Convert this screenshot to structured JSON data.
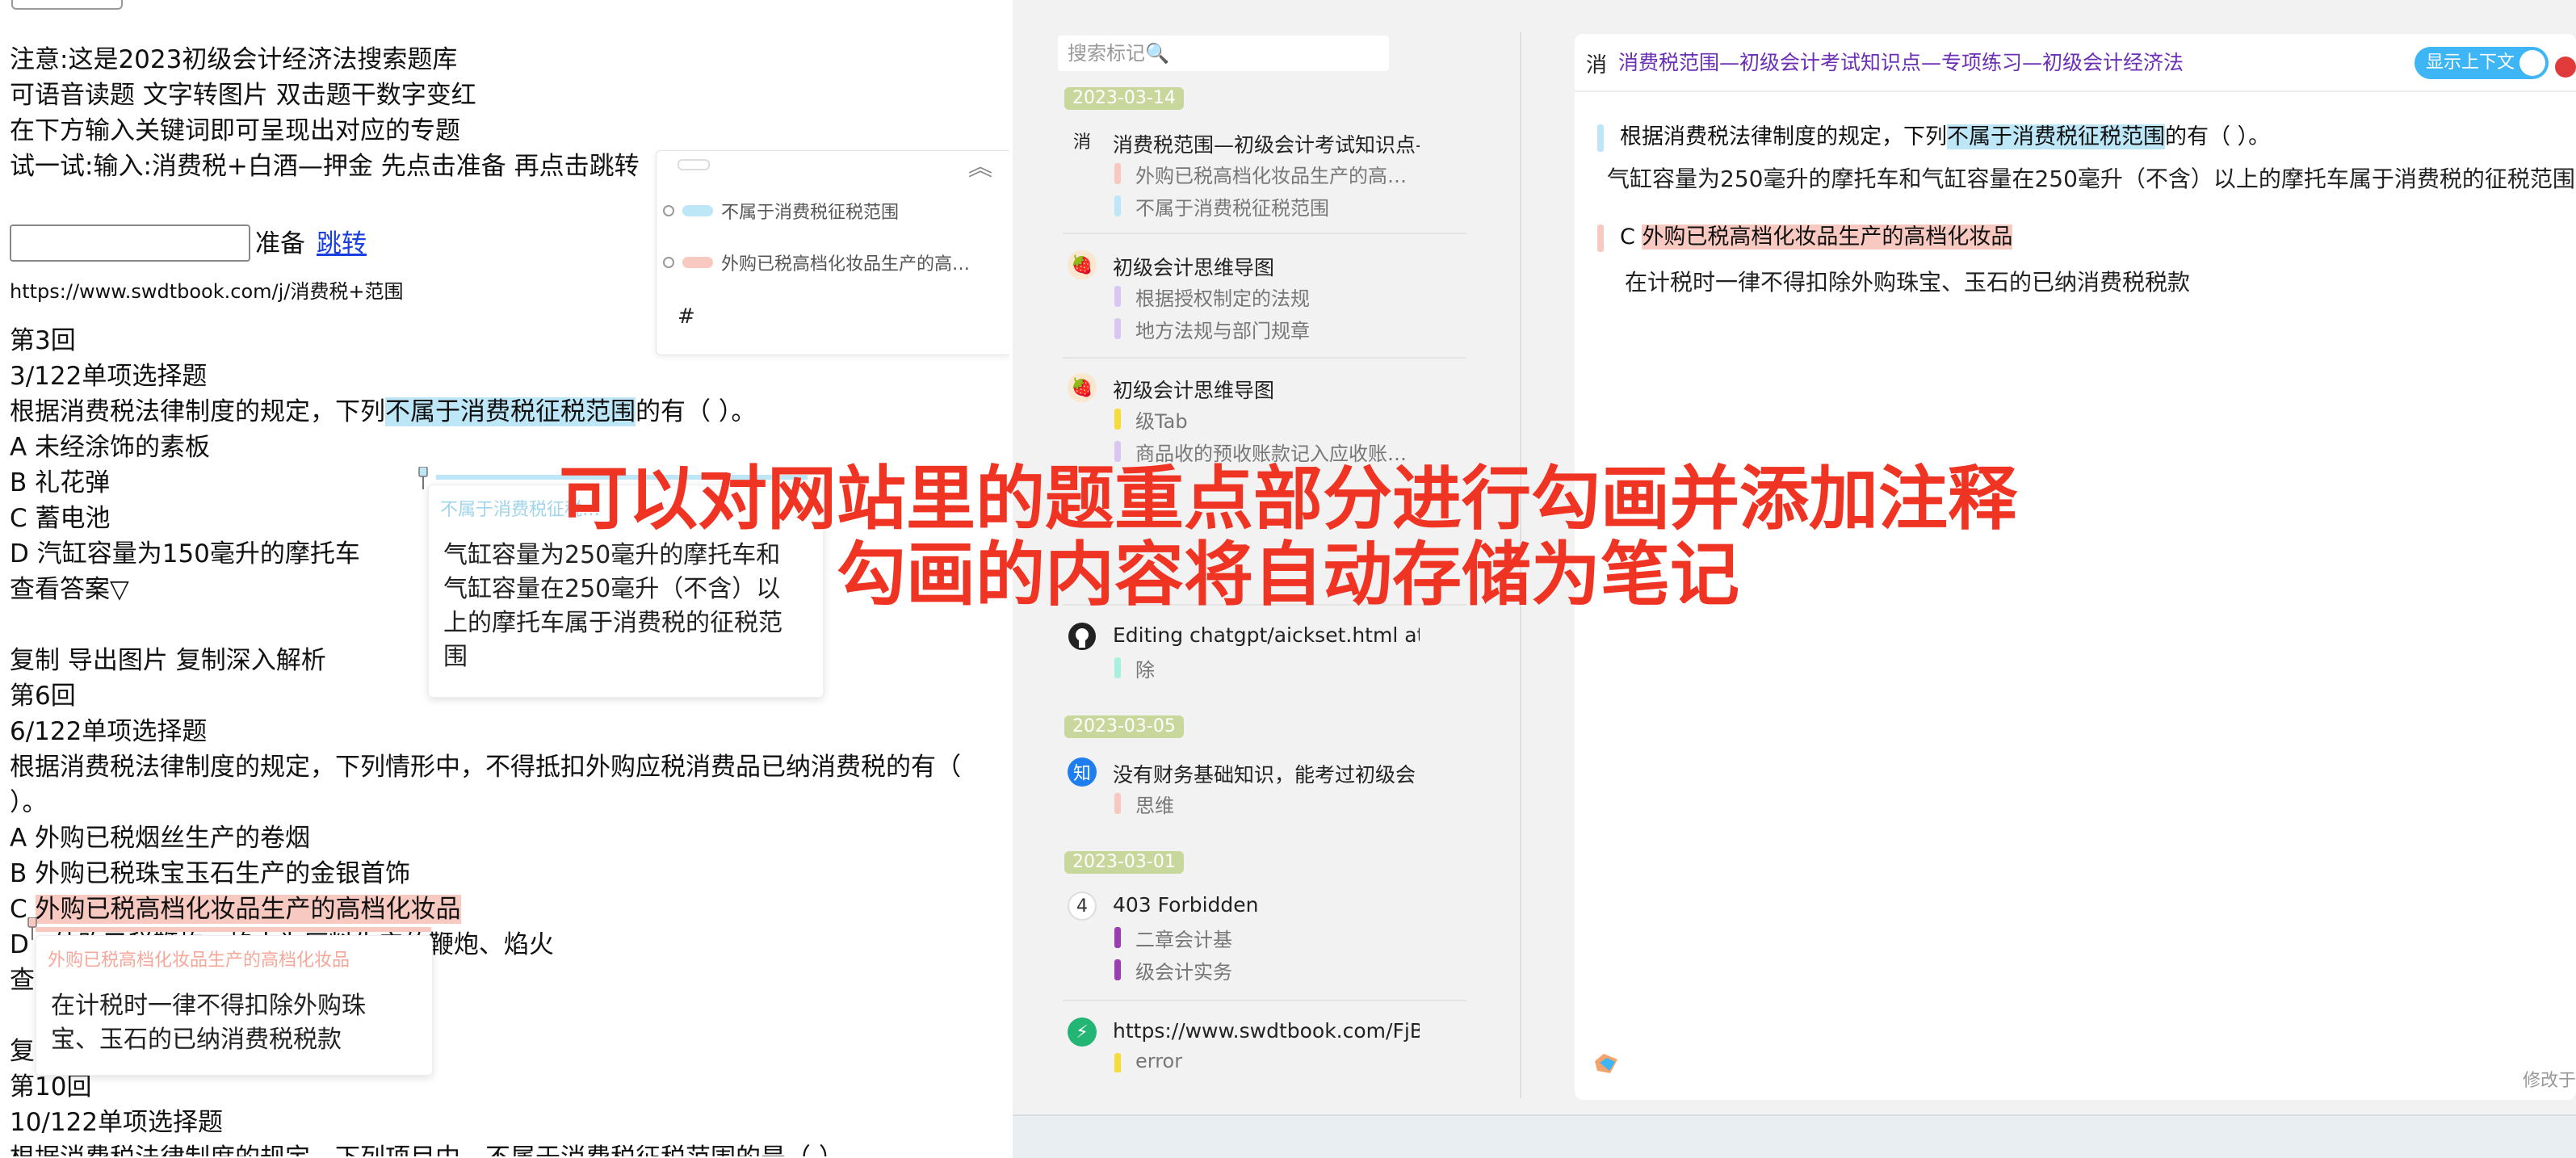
{
  "left": {
    "intro": [
      "注意:这是2023初级会计经济法搜索题库",
      "可语音读题 文字转图片 双击题干数字变红",
      "在下方输入关键词即可呈现出对应的专题",
      "试一试:输入:消费税+白酒—押金 先点击准备 再点击跳转"
    ],
    "search_value": "",
    "prepare_label": "准备",
    "jump_label": "跳转",
    "url_text": "https://www.swdtbook.com/j/消费税+范围",
    "q3_round": "第3回",
    "q3_type": "3/122单项选择题",
    "q3_stem_a": "根据消费税法律制度的规定，下列",
    "q3_stem_hl": "不属于消费税征税范围",
    "q3_stem_b": "的有（ ）。",
    "q3_opts": [
      "A 未经涂饰的素板",
      "B 礼花弹",
      "C 蓄电池",
      "D 汽缸容量为150毫升的摩托车"
    ],
    "view_answer": "查看答案▽",
    "actions": "复制 导出图片 复制深入解析",
    "q6_round": "第6回",
    "q6_type": "6/122单项选择题",
    "q6_stem": "根据消费税法律制度的规定，下列情形中，不得抵扣外购应税消费品已纳消费税的有（",
    "q6_stem2": "）。",
    "q6_opt_a": "A 外购已税烟丝生产的卷烟",
    "q6_opt_b": "B 外购已税珠宝玉石生产的金银首饰",
    "q6_opt_c_prefix": "C ",
    "q6_opt_c_hl": "外购已税高档化妆品生产的高档化妆品",
    "q6_opt_d_left": "D",
    "q6_opt_d_right": "外购已税鞭炮、焰火为原料生产的鞭炮、焰火",
    "q6_view_partial": "查",
    "copy_partial": "复",
    "q10_round": "第10回",
    "q10_type": "10/122单项选择题",
    "q10_stem": "根据消费税法律制度的规定，下列项目中，不属于消费税征税范围的是（ ）。"
  },
  "mark_popup": {
    "items": [
      {
        "label": "不属于消费税征税范围",
        "color": "#bde6f7"
      },
      {
        "label": "外购已税高档化妆品生产的高…",
        "color": "#f8c9c0"
      }
    ],
    "hash": "#"
  },
  "note1": {
    "title": "不属于消费税征税…",
    "lines": [
      "气缸容量为250毫升的摩托车和",
      "气缸容量在250毫升（不含）以",
      "上的摩托车属于消费税的征税范",
      "围"
    ]
  },
  "note2": {
    "title": "外购已税高档化妆品生产的高档化妆品",
    "lines": [
      "在计税时一律不得扣除外购珠",
      "宝、玉石的已纳消费税税款"
    ]
  },
  "sidebar": {
    "search_placeholder": "搜索标记🔍",
    "dates": [
      "2023-03-14",
      "2023-03-05",
      "2023-03-01"
    ],
    "entries": [
      {
        "icon": "消",
        "title": "消费税范围—初级会计考试知识点—",
        "subs": [
          {
            "text": "外购已税高档化妆品生产的高…",
            "color": "#f8c9c0"
          },
          {
            "text": "不属于消费税征税范围",
            "color": "#bde6f7"
          }
        ]
      },
      {
        "icon": "🍓",
        "title": "初级会计思维导图",
        "subs": [
          {
            "text": "根据授权制定的法规",
            "color": "#d8c8f0"
          },
          {
            "text": "地方法规与部门规章",
            "color": "#d8c8f0"
          }
        ]
      },
      {
        "icon": "🍓",
        "title": "初级会计思维导图",
        "subs": [
          {
            "text": "级Tab",
            "color": "#f5dc3c"
          },
          {
            "text": "商品收的预收账款记入应收账…",
            "color": "#d8c8f0"
          }
        ]
      },
      {
        "icon": "",
        "title": "…",
        "subs": []
      },
      {
        "icon": "GH",
        "title": "Editing chatgpt/aickset.html at r",
        "subs": [
          {
            "text": "除",
            "color": "#a8f0e0"
          }
        ]
      },
      {
        "icon": "知",
        "title": "没有财务基础知识，能考过初级会",
        "subs": [
          {
            "text": "思维",
            "color": "#f8c9c0"
          }
        ]
      },
      {
        "icon": "4",
        "title": "403 Forbidden",
        "subs": [
          {
            "text": "二章会计基",
            "color": "#9a3fb0"
          },
          {
            "text": "级会计实务",
            "color": "#9a3fb0"
          }
        ]
      },
      {
        "icon": "⚡",
        "title": "https://www.swdtbook.com/FjBI",
        "subs": [
          {
            "text": "error",
            "color": "#f5dc3c"
          }
        ]
      }
    ]
  },
  "detail": {
    "favicon": "消",
    "title": "消费税范围—初级会计考试知识点—专项练习—初级会计经济法",
    "toggle_label": "显示上下文",
    "block1_a": "根据消费税法律制度的规定，下列",
    "block1_hl": "不属于消费税征税范围",
    "block1_b": "的有（ ）。",
    "note1": "气缸容量为250毫升的摩托车和气缸容量在250毫升（不含）以上的摩托车属于消费税的征税范围",
    "block2_prefix": "C ",
    "block2_hl": "外购已税高档化妆品生产的高档化妆品",
    "note2": "在计税时一律不得扣除外购珠宝、玉石的已纳消费税税款",
    "footer": "修改于"
  },
  "overlay": {
    "line1": "可以对网站里的题重点部分进行勾画并添加注释",
    "line2": "勾画的内容将自动存储为笔记"
  },
  "colors": {
    "highlight_blue": "#bde6f7",
    "highlight_red": "#f8c9c0",
    "overlay_red": "#f03424",
    "link_blue": "#1a3fe0",
    "title_purple": "#6b2fb5",
    "toggle_blue": "#3eb5f4"
  }
}
